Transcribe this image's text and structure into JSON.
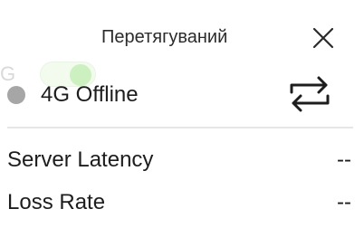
{
  "header": {
    "title": "Перетягуваний"
  },
  "ghost": {
    "label": "G"
  },
  "connection": {
    "status_text": "4G Offline",
    "status_color": "#a6a6a6"
  },
  "stats": [
    {
      "label": "Server Latency",
      "value": "--"
    },
    {
      "label": "Loss Rate",
      "value": "--"
    }
  ],
  "icons": {
    "close": "close-icon",
    "swap": "swap-arrows-icon"
  }
}
